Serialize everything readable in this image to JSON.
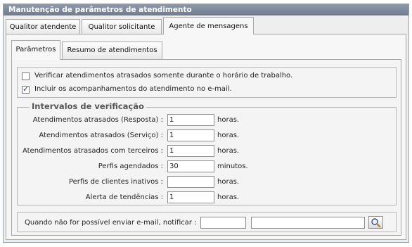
{
  "window": {
    "title": "Manutenção de parâmetros de atendimento"
  },
  "top_tabs": [
    {
      "label": "Qualitor atendente"
    },
    {
      "label": "Qualitor solicitante"
    },
    {
      "label": "Agente de mensagens"
    }
  ],
  "sub_tabs": [
    {
      "label": "Parâmetros"
    },
    {
      "label": "Resumo de atendimentos"
    }
  ],
  "options": [
    {
      "label": "Verificar atendimentos atrasados somente durante o horário de trabalho.",
      "checked": false
    },
    {
      "label": "Incluir os acompanhamentos do atendimento no e-mail.",
      "checked": true
    }
  ],
  "intervals": {
    "legend": "Intervalos de verificação",
    "rows": [
      {
        "label": "Atendimentos atrasados (Resposta) :",
        "value": "1",
        "unit": "horas."
      },
      {
        "label": "Atendimentos atrasados (Serviço) :",
        "value": "1",
        "unit": "horas."
      },
      {
        "label": "Atendimentos atrasados com terceiros :",
        "value": "1",
        "unit": "horas."
      },
      {
        "label": "Perfis agendados :",
        "value": "30",
        "unit": "minutos."
      },
      {
        "label": "Perfis de clientes inativos :",
        "value": "",
        "unit": "horas."
      },
      {
        "label": "Alerta de tendências :",
        "value": "1",
        "unit": "horas."
      }
    ]
  },
  "notify": {
    "label": "Quando não for possível enviar e-mail, notificar :",
    "code": "",
    "name": ""
  },
  "icons": {
    "search": "magnifier-icon"
  }
}
